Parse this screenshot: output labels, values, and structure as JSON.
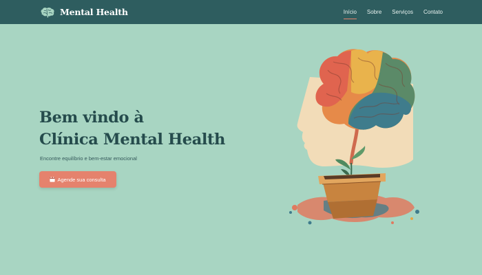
{
  "navbar": {
    "brand": "Mental Health",
    "brand_icon": "brain-icon",
    "links": [
      {
        "label": "Início",
        "active": true
      },
      {
        "label": "Sobre",
        "active": false
      },
      {
        "label": "Serviços",
        "active": false
      },
      {
        "label": "Contato",
        "active": false
      }
    ]
  },
  "hero": {
    "title_line1": "Bem vindo à",
    "title_line2": "Clínica Mental Health",
    "subtitle": "Encontre equilíbrio e bem-estar emocional",
    "cta_label": "Agende sua consulta",
    "cta_icon": "calendar-icon",
    "illustration": "head-brain-plant-illustration"
  },
  "colors": {
    "background": "#a8d5c2",
    "navbar": "#2e5d5f",
    "accent": "#e5826d",
    "heading": "#254b4c"
  }
}
